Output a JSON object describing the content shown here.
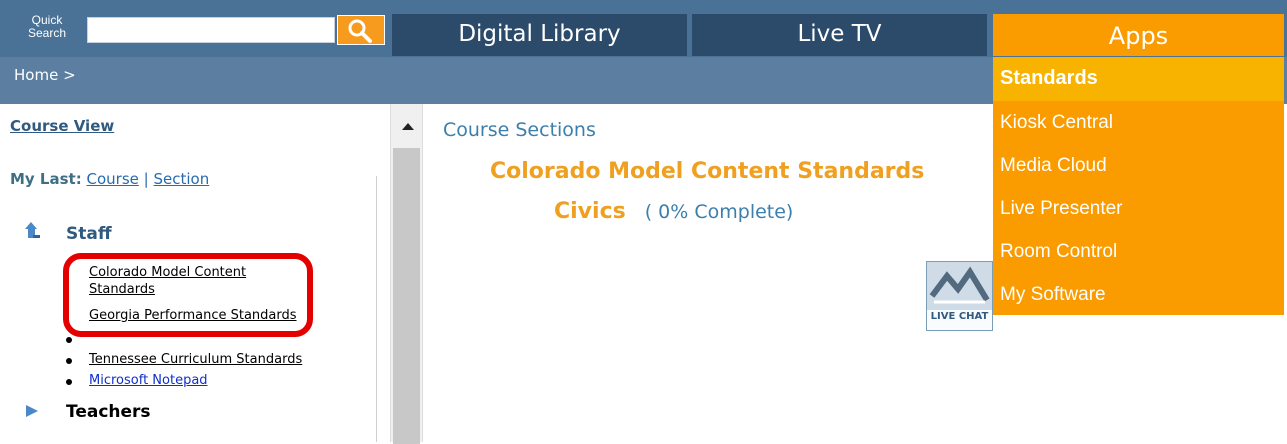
{
  "header": {
    "quick_search_line1": "Quick",
    "quick_search_line2": "Search",
    "search_value": "",
    "search_placeholder": "",
    "tabs": [
      "Digital Library",
      "Live TV",
      "Apps"
    ]
  },
  "breadcrumb": "Home >",
  "apps_menu": {
    "items": [
      "Standards",
      "Kiosk Central",
      "Media Cloud",
      "Live Presenter",
      "Room Control",
      "My Software"
    ]
  },
  "sidebar": {
    "course_view": "Course View",
    "my_last_label": "My Last:",
    "course_link": "Course",
    "separator": "|",
    "section_link": "Section",
    "staff_label": "Staff",
    "staff_items": [
      "Colorado Model Content Standards",
      "Georgia Performance Standards",
      "Tennessee Curriculum Standards",
      "Microsoft Notepad"
    ],
    "teachers_label": "Teachers"
  },
  "main": {
    "section_heading": "Course Sections",
    "course_title": "Colorado Model Content Standards",
    "subject": "Civics",
    "progress": "( 0% Complete)",
    "progress_percent": 0,
    "live_chat": "LIVE CHAT"
  },
  "colors": {
    "header": "#4a7196",
    "nav_tab": "#2c4b6b",
    "accent_orange": "#fa9b00",
    "standards_highlight": "#f7b300",
    "highlight_box": "#e50000"
  }
}
